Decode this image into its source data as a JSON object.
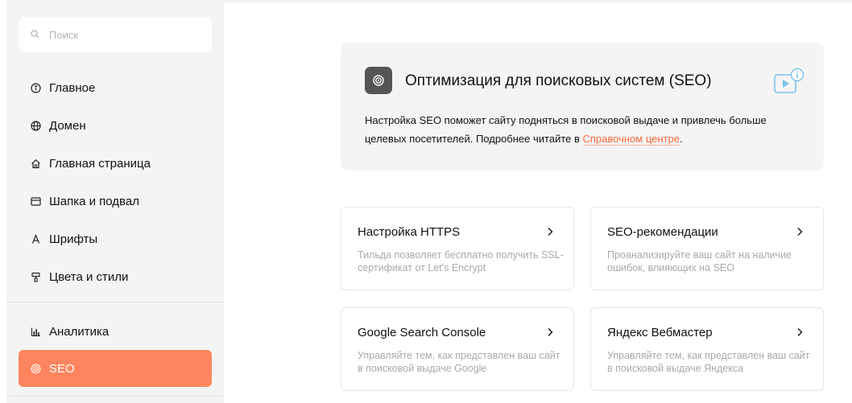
{
  "search": {
    "placeholder": "Поиск"
  },
  "sidebar": {
    "items": [
      {
        "label": "Главное",
        "icon": "info-icon"
      },
      {
        "label": "Домен",
        "icon": "globe-icon"
      },
      {
        "label": "Главная страница",
        "icon": "home-icon"
      },
      {
        "label": "Шапка и подвал",
        "icon": "layout-icon"
      },
      {
        "label": "Шрифты",
        "icon": "font-icon"
      },
      {
        "label": "Цвета и стили",
        "icon": "paint-roller-icon"
      },
      {
        "label": "Аналитика",
        "icon": "bar-chart-icon"
      },
      {
        "label": "SEO",
        "icon": "target-icon",
        "active": true
      }
    ]
  },
  "intro": {
    "title": "Оптимизация для поисковых систем (SEO)",
    "desc_before": "Настройка SEO поможет сайту подняться в поисковой выдаче и привлечь больше целевых посетителей. Подробнее читайте в ",
    "link": "Справочном центре",
    "desc_after": "."
  },
  "cards": [
    {
      "title": "Настройка HTTPS",
      "desc": "Тильда позволяет бесплатно получить SSL-сертификат от Let's Encrypt"
    },
    {
      "title": "SEO-рекомендации",
      "desc": "Проанализируйте ваш сайт на наличие ошибок, влияющих на SEO"
    },
    {
      "title": "Google Search Console",
      "desc": "Управляйте тем, как представлен ваш сайт в поисковой выдаче Google"
    },
    {
      "title": "Яндекс Вебмастер",
      "desc": "Управляйте тем, как представлен ваш сайт в поисковой выдаче Яндекса"
    }
  ],
  "colors": {
    "accent": "#ff855e",
    "link": "#ff6b3d",
    "panel": "#f4f4f4",
    "video_icon": "#7cc3e8"
  }
}
